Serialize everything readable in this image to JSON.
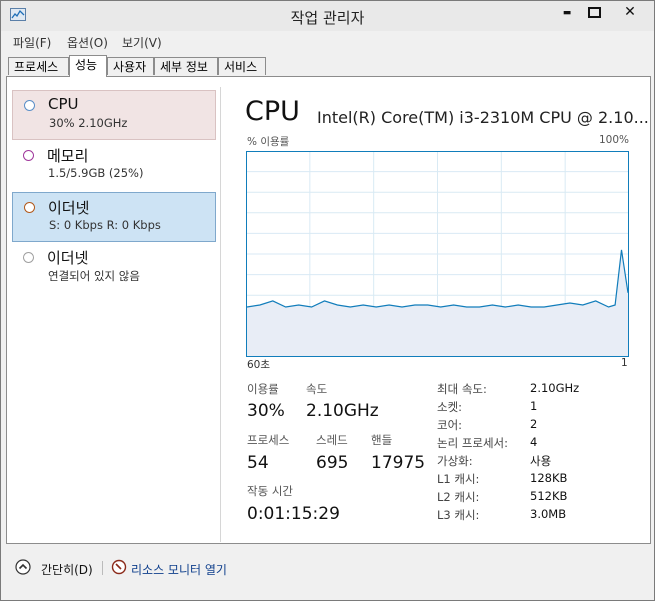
{
  "window": {
    "title": "작업 관리자",
    "min_glyph": "▬",
    "max_glyph": "■",
    "close_glyph": "✕"
  },
  "menu": [
    "파일(F)",
    "옵션(O)",
    "보기(V)"
  ],
  "tabs": [
    "프로세스",
    "성능",
    "사용자",
    "세부 정보",
    "서비스"
  ],
  "active_tab": "성능",
  "resources": [
    {
      "name": "CPU",
      "sub": "30% 2.10GHz",
      "circle_color": "#5a8fc8"
    },
    {
      "name": "메모리",
      "sub": "1.5/5.9GB (25%)",
      "circle_color": "#a0389c"
    },
    {
      "name": "이더넷",
      "sub": "S: 0 Kbps R: 0 Kbps",
      "circle_color": "#b25a1c"
    },
    {
      "name": "이더넷",
      "sub": "연결되어 있지 않음",
      "circle_color": "#a0a0a0"
    }
  ],
  "detail": {
    "title": "CPU",
    "cpu_name": "Intel(R) Core(TM) i3-2310M CPU @ 2.10...",
    "graph_label_top_left": "% 이용률",
    "graph_label_top_right": "100%",
    "graph_label_bottom_left": "60초",
    "graph_label_bottom_right": "1"
  },
  "stats": {
    "utilization_label": "이용률",
    "utilization_value": "30%",
    "speed_label": "속도",
    "speed_value": "2.10GHz",
    "processes_label": "프로세스",
    "processes_value": "54",
    "threads_label": "스레드",
    "threads_value": "695",
    "handles_label": "핸들",
    "handles_value": "17975",
    "uptime_label": "작동 시간",
    "uptime_value": "0:01:15:29"
  },
  "specs": [
    {
      "key": "최대 속도:",
      "value": "2.10GHz"
    },
    {
      "key": "소켓:",
      "value": "1"
    },
    {
      "key": "코어:",
      "value": "2"
    },
    {
      "key": "논리 프로세서:",
      "value": "4"
    },
    {
      "key": "가상화:",
      "value": "사용"
    },
    {
      "key": "L1 캐시:",
      "value": "128KB"
    },
    {
      "key": "L2 캐시:",
      "value": "512KB"
    },
    {
      "key": "L3 캐시:",
      "value": "3.0MB"
    }
  ],
  "footer": {
    "fewer_details": "간단히(D)",
    "resource_monitor": "리소스 모니터 열기"
  },
  "chart_data": {
    "type": "area",
    "ylabel": "% 이용률",
    "ylim": [
      0,
      100
    ],
    "x": [
      60,
      58,
      56,
      54,
      52,
      50,
      48,
      46,
      44,
      42,
      40,
      38,
      36,
      34,
      32,
      30,
      28,
      26,
      24,
      22,
      20,
      18,
      16,
      14,
      12,
      10,
      8,
      6,
      4,
      3,
      2,
      1
    ],
    "values": [
      24,
      25,
      27,
      24,
      25,
      24,
      27,
      25,
      24,
      25,
      24,
      25,
      24,
      25,
      25,
      24,
      25,
      24,
      24,
      25,
      24,
      25,
      24,
      24,
      25,
      26,
      25,
      27,
      24,
      25,
      52,
      31
    ],
    "grid": true,
    "line_color": "#117dbb",
    "fill_color": "#e8edf6"
  }
}
